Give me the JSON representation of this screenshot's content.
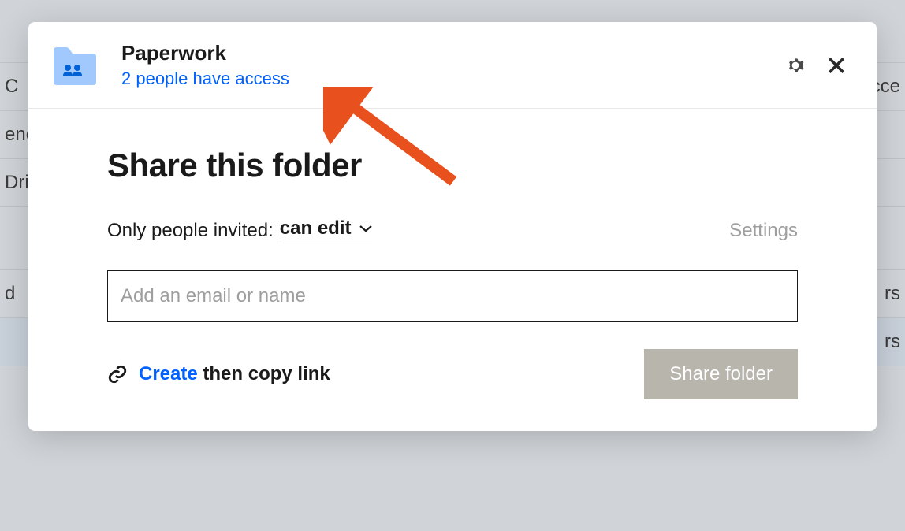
{
  "background": {
    "rows": [
      {
        "left": "",
        "right": ""
      },
      {
        "left": "C",
        "right": "cce"
      },
      {
        "left": "enc",
        "right": ""
      },
      {
        "left": "Dri",
        "right": ""
      },
      {
        "left": "",
        "right": ""
      },
      {
        "left": "d",
        "right": "rs"
      },
      {
        "left": "",
        "right": "rs"
      }
    ]
  },
  "header": {
    "folder_name": "Paperwork",
    "access_link": "2 people have access"
  },
  "body": {
    "title": "Share this folder",
    "perm_label": "Only people invited:",
    "perm_value": "can edit",
    "settings": "Settings",
    "email_placeholder": "Add an email or name"
  },
  "footer": {
    "create": "Create",
    "copy_text": "then copy link",
    "share_button": "Share folder"
  }
}
